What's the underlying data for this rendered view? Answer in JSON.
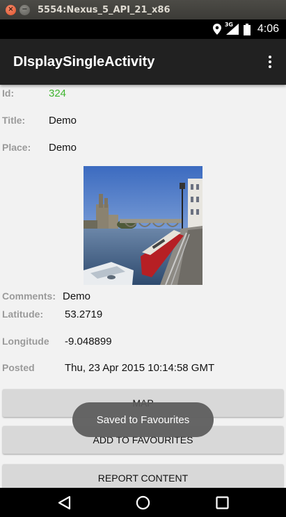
{
  "window": {
    "title": "5554:Nexus_5_API_21_x86",
    "close_glyph": "×",
    "minimize_glyph": "−"
  },
  "status_bar": {
    "network": "3G",
    "time": "4:06",
    "icons": [
      "location-icon",
      "signal-icon",
      "battery-icon"
    ]
  },
  "action_bar": {
    "title": "DIsplaySingleActivity",
    "menu_icon": "overflow-menu-icon"
  },
  "details": {
    "id_label": "Id:",
    "id_value": "324",
    "title_label": "Title:",
    "title_value": "Demo",
    "place_label": "Place:",
    "place_value": "Demo",
    "comments_label": "Comments:",
    "comments_value": "Demo",
    "latitude_label": "Latitude:",
    "latitude_value": "53.2719",
    "longitude_label": "Longitude",
    "longitude_value": "-9.048899",
    "posted_label": "Posted",
    "posted_value": "Thu, 23 Apr 2015 10:14:58 GMT"
  },
  "buttons": {
    "map": "MAP",
    "favourites": "ADD TO FAVOURITES",
    "report": "REPORT CONTENT"
  },
  "toast": {
    "message": "Saved to Favourites"
  },
  "nav_bar": {
    "icons": [
      "back-icon",
      "home-icon",
      "recents-icon"
    ]
  },
  "colors": {
    "id_value": "#3fb52f",
    "action_bar": "#212121",
    "button": "#d8d8d8",
    "background": "#f2f2f2"
  }
}
